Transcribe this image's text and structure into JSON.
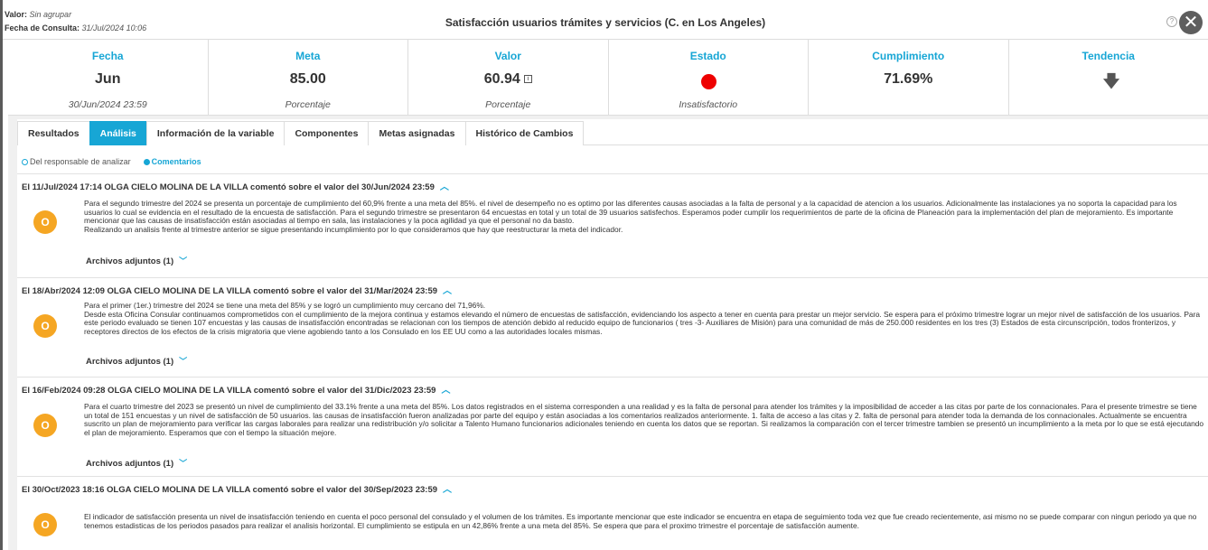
{
  "header": {
    "valor_label": "Valor:",
    "valor_value": "Sin agrupar",
    "fecha_label": "Fecha de Consulta:",
    "fecha_value": "31/Jul/2024 10:06",
    "title": "Satisfacción usuarios trámites y servicios (C. en Los Angeles)",
    "help_icon": "question-icon",
    "close_icon": "close-icon"
  },
  "summary": {
    "fecha": {
      "label": "Fecha",
      "value": "Jun",
      "sub": "30/Jun/2024 23:59"
    },
    "meta": {
      "label": "Meta",
      "value": "85.00",
      "sub": "Porcentaje"
    },
    "valor": {
      "label": "Valor",
      "value": "60.94",
      "sub": "Porcentaje"
    },
    "estado": {
      "label": "Estado",
      "sub": "Insatisfactorio",
      "color": "#ee0000"
    },
    "cumplimiento": {
      "label": "Cumplimiento",
      "value": "71.69%"
    },
    "tendencia": {
      "label": "Tendencia",
      "icon": "arrow-down-icon"
    }
  },
  "tabs": [
    {
      "label": "Resultados"
    },
    {
      "label": "Análisis"
    },
    {
      "label": "Información de la variable"
    },
    {
      "label": "Componentes"
    },
    {
      "label": "Metas asignadas"
    },
    {
      "label": "Histórico de Cambios"
    }
  ],
  "active_tab": "Análisis",
  "filters": {
    "option1": "Del responsable de analizar",
    "option2": "Comentarios",
    "selected": "Comentarios"
  },
  "comments": [
    {
      "header": "El 11/Jul/2024 17:14 OLGA CIELO MOLINA DE LA VILLA comentó sobre el valor del 30/Jun/2024 23:59",
      "avatar": "O",
      "body": [
        "Para el segundo trimestre del 2024 se presenta un porcentaje de cumplimiento del 60,9% frente a una meta del 85%. el nivel de desempeño no es optimo por las diferentes causas asociadas a la falta de personal y a la capacidad de atencion a los usuarios. Adicionalmente las instalaciones ya no soporta la capacidad para los usuarios lo cual se evidencia en el resultado de la encuesta de satisfacción. Para el segundo trimestre se presentaron 64 encuestas en total y un total de 39 usuarios satisfechos. Esperamos poder cumplir los requerimientos de parte de la oficina de Planeación para la implementación del plan de mejoramiento. Es importante mencionar que las causas de insatisfacción están asociadas al tiempo en sala, las instalaciones y la poca agilidad ya que el personal no da basto.",
        "Realizando un analisis frente al trimestre anterior se sigue presentando incumplimiento por lo que consideramos que hay que reestructurar la meta del indicador."
      ],
      "attachments": "Archivos adjuntos (1)"
    },
    {
      "header": "El 18/Abr/2024 12:09 OLGA CIELO MOLINA DE LA VILLA comentó sobre el valor del 31/Mar/2024 23:59",
      "avatar": "O",
      "body": [
        "Para el primer (1er.) trimestre del 2024 se tiene una meta del 85% y se logró un cumplimiento muy cercano del 71,96%.",
        "Desde esta Oficina Consular continuamos comprometidos con el cumplimiento de la mejora continua y estamos elevando el número de encuestas de satisfacción, evidenciando los aspecto a tener en cuenta para prestar un mejor servicio. Se espera para el próximo trimestre lograr un mejor nivel de satisfacción de los usuarios. Para este periodo evaluado se tienen 107 encuestas y las causas de insatisfacción encontradas se relacionan con los tiempos de atención debido al reducido equipo de funcionarios ( tres -3- Auxiliares de Misión) para una comunidad de más de 250.000 residentes en los tres (3) Estados de esta circunscripción, todos fronterizos, y receptores directos de los efectos de la crisis migratoria que viene agobiendo tanto a los Consulado en los EE UU como a las autoridades locales mismas."
      ],
      "attachments": "Archivos adjuntos (1)"
    },
    {
      "header": "El 16/Feb/2024 09:28 OLGA CIELO MOLINA DE LA VILLA comentó sobre el valor del 31/Dic/2023 23:59",
      "avatar": "O",
      "body": [
        "Para el cuarto trimestre del 2023 se presentó un nivel de cumplimiento del 33.1% frente a una meta del 85%. Los datos registrados en el sistema corresponden a una realidad y es la falta de personal para atender los trámites y la imposibilidad de acceder a las citas por parte de los connacionales. Para el presente trimestre se tiene un total de 151 encuestas y un nivel de satisfacción de 50 usuarios. las causas de insatisfacción fueron analizadas por parte del equipo y están asociadas a los comentarios realizados anteriormente. 1. falta de acceso a las citas y 2. falta de personal para atender toda la demanda de los connacionales. Actualmente se encuentra suscrito un plan de mejoramiento para verificar las cargas laborales para realizar una redistribución y/o solicitar a Talento Humano funcionarios adicionales teniendo en cuenta los datos que se reportan. Si realizamos la comparación con el tercer trimestre tambien se presentó un incumplimiento a la meta por lo que se está ejecutando el plan de mejoramiento. Esperamos que con el tiempo la situación mejore."
      ],
      "attachments": "Archivos adjuntos (1)"
    },
    {
      "header": "El 30/Oct/2023 18:16 OLGA CIELO MOLINA DE LA VILLA comentó sobre el valor del 30/Sep/2023 23:59",
      "avatar": "O",
      "body": [
        "El indicador de satisfacción presenta un nivel de insatisfacción teniendo en cuenta el poco personal del consulado y el volumen de los trámites. Es importante mencionar que este indicador se encuentra en etapa de seguimiento toda vez que fue creado recientemente, asi mismo no se puede comparar con ningun periodo ya que no tenemos estadisticas de los periodos pasados para realizar el analisis horizontal. El cumplimiento se estipula en un 42,86% frente a una meta del 85%. Se espera que para el proximo trimestre el porcentaje de satisfacción aumente."
      ],
      "attachments": ""
    }
  ]
}
